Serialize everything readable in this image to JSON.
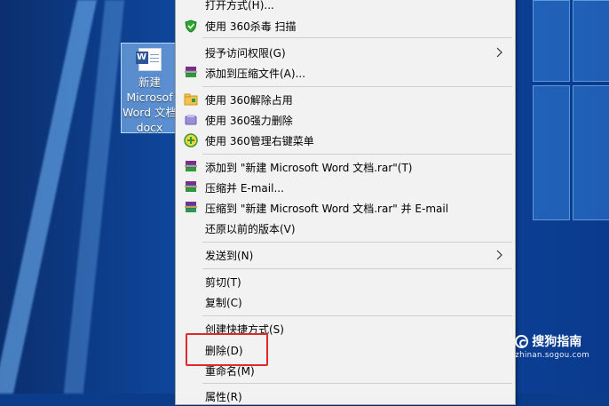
{
  "desktop_icon": {
    "name_line1": "新建",
    "name_line2": "Microsof",
    "name_line3": "Word 文档",
    "name_line4": "docx",
    "badge": "W"
  },
  "context_menu": {
    "items": [
      {
        "label": "打开方式(H)...",
        "icon": null,
        "submenu": false
      },
      {
        "label": "使用 360杀毒 扫描",
        "icon": "shield-360-icon",
        "submenu": false
      },
      {
        "label": "授予访问权限(G)",
        "icon": null,
        "submenu": true
      },
      {
        "label": "添加到压缩文件(A)...",
        "icon": "winrar-icon",
        "submenu": false
      },
      {
        "label": "使用 360解除占用",
        "icon": "unlock-folder-icon",
        "submenu": false
      },
      {
        "label": "使用 360强力删除",
        "icon": "force-delete-icon",
        "submenu": false
      },
      {
        "label": "使用 360管理右键菜单",
        "icon": "menu-manager-icon",
        "submenu": false
      },
      {
        "label": "添加到 \"新建 Microsoft Word 文档.rar\"(T)",
        "icon": "winrar-icon",
        "submenu": false
      },
      {
        "label": "压缩并 E-mail...",
        "icon": "winrar-icon",
        "submenu": false
      },
      {
        "label": "压缩到 \"新建 Microsoft Word 文档.rar\" 并 E-mail",
        "icon": "winrar-icon",
        "submenu": false
      },
      {
        "label": "还原以前的版本(V)",
        "icon": null,
        "submenu": false
      },
      {
        "label": "发送到(N)",
        "icon": null,
        "submenu": true
      },
      {
        "label": "剪切(T)",
        "icon": null,
        "submenu": false
      },
      {
        "label": "复制(C)",
        "icon": null,
        "submenu": false
      },
      {
        "label": "创建快捷方式(S)",
        "icon": null,
        "submenu": false
      },
      {
        "label": "删除(D)",
        "icon": null,
        "submenu": false,
        "highlighted": true
      },
      {
        "label": "重命名(M)",
        "icon": null,
        "submenu": false
      },
      {
        "label": "属性(R)",
        "icon": null,
        "submenu": false
      }
    ]
  },
  "watermark": {
    "brand": "搜狗指南",
    "url": "zhinan.sogou.com"
  },
  "colors": {
    "highlight_border": "#e02a2a",
    "menu_bg": "#f2f2f2",
    "desktop_blue": "#0d47a1"
  }
}
